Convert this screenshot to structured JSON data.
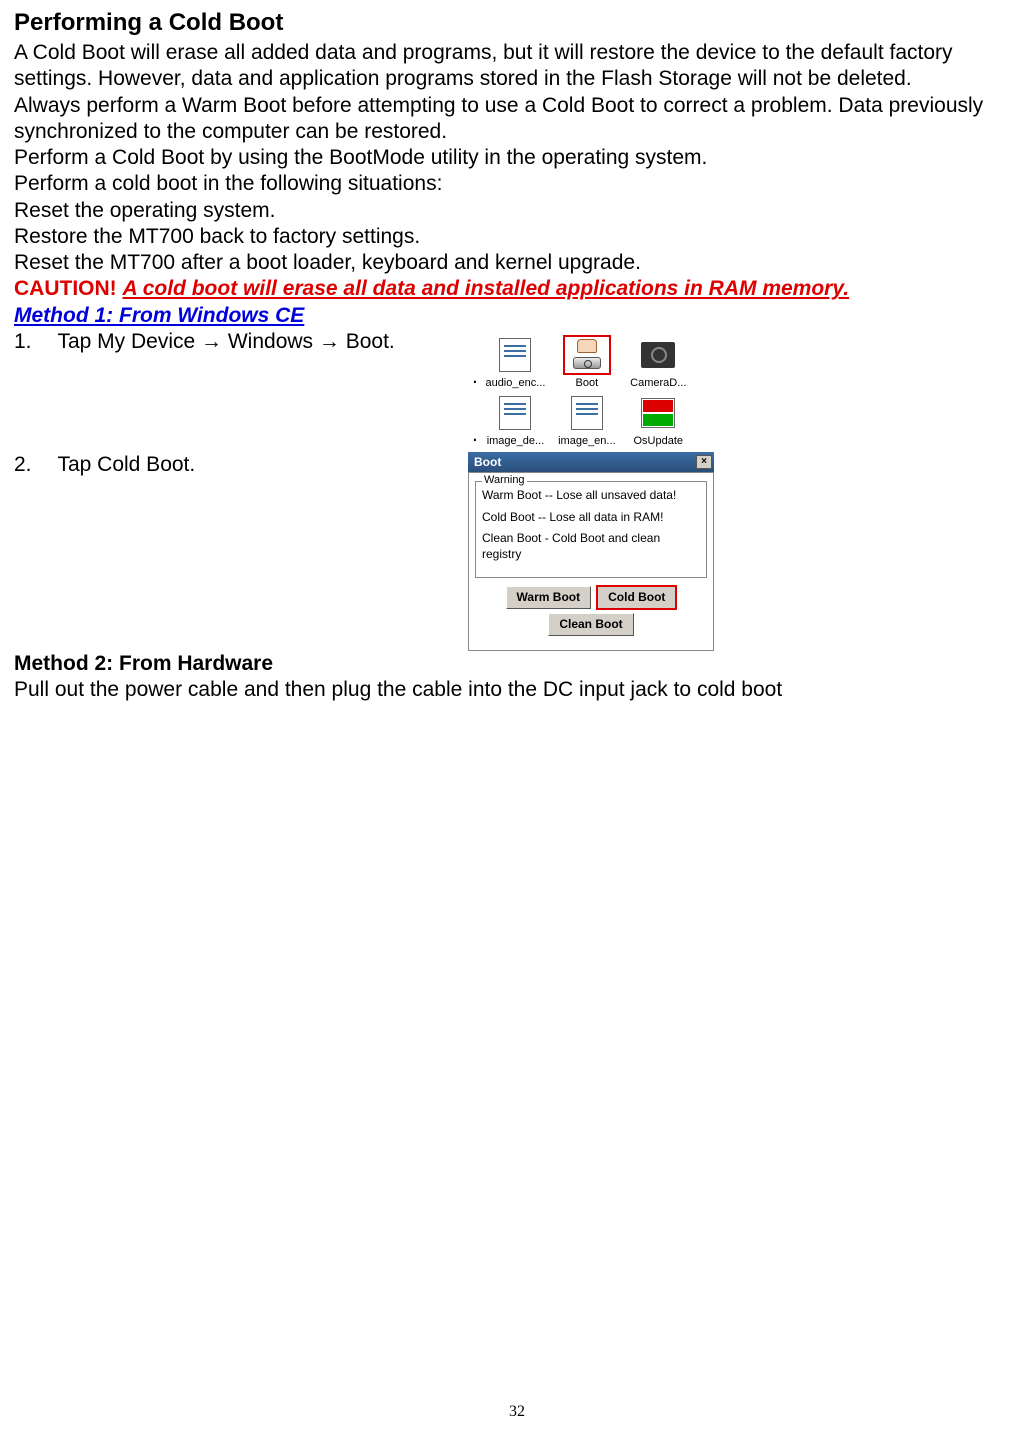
{
  "heading": "Performing a Cold Boot",
  "para1": "A Cold Boot will erase all added data and programs, but it will restore the device to the default factory settings. However, data and application programs stored in the Flash Storage will not be deleted.",
  "para2": "Always perform a Warm Boot before attempting to use a Cold Boot to correct a problem. Data previously synchronized to the computer can be restored.",
  "para3": "Perform a Cold Boot by using the BootMode utility in the operating system.",
  "para4": "Perform a cold boot in the following situations:",
  "situations": [
    "Reset the operating system.",
    "Restore the MT700 back to factory settings.",
    "Reset the MT700 after a boot loader, keyboard and kernel upgrade."
  ],
  "caution_prefix": "CAUTION! ",
  "caution_text": "A cold boot will erase all data and installed applications in RAM memory.",
  "method1_title": "Method 1: From Windows CE",
  "step1_num": "1.",
  "step1_text_a": "Tap My Device ",
  "step1_arrow1": "→",
  "step1_text_b": " Windows ",
  "step1_arrow2": "→",
  "step1_text_c": " Boot.",
  "step2_num": "2.",
  "step2_text": "Tap Cold Boot.",
  "method2_title": "Method 2: From Hardware",
  "method2_text": "Pull out the power cable and then plug the cable into the DC input jack to cold boot",
  "page_number": "32",
  "fig1": {
    "dot": ".",
    "icons": {
      "audio_enc": "audio_enc...",
      "boot": "Boot",
      "camerad": "CameraD...",
      "image_de": "image_de...",
      "image_en": "image_en...",
      "osupdate": "OsUpdate"
    }
  },
  "fig2": {
    "title": "Boot",
    "close": "×",
    "legend": "Warning",
    "warm_line": "Warm Boot -- Lose all unsaved data!",
    "cold_line": "Cold Boot -- Lose all data in RAM!",
    "clean_line": "Clean Boot - Cold Boot and clean registry",
    "warm_btn": "Warm Boot",
    "cold_btn": "Cold Boot",
    "clean_btn": "Clean Boot"
  }
}
